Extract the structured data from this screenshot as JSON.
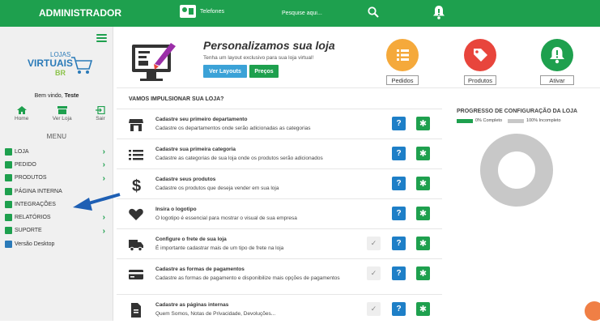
{
  "header": {
    "title": "ADMINISTRADOR",
    "phone_label": "Telefones",
    "search_placeholder": "Pesquise aqui...",
    "icons": [
      "phone-card-icon",
      "search-icon",
      "bell-icon"
    ]
  },
  "sidebar": {
    "logo_text": "LOJAS VIRTUAIS BR",
    "welcome_prefix": "Bem vindo, ",
    "user": "Teste",
    "quick": [
      {
        "label": "Home",
        "icon": "home-icon"
      },
      {
        "label": "Ver Loja",
        "icon": "store-icon"
      },
      {
        "label": "Sair",
        "icon": "exit-icon"
      }
    ],
    "menu_title": "MENU",
    "items": [
      {
        "label": "LOJA",
        "icon": "store-icon",
        "chevron": true
      },
      {
        "label": "PEDIDO",
        "icon": "list-icon",
        "chevron": true
      },
      {
        "label": "PRODUTOS",
        "icon": "plus-icon",
        "chevron": true
      },
      {
        "label": "PÁGINA INTERNA",
        "icon": "page-icon",
        "chevron": false
      },
      {
        "label": "INTEGRAÇÕES",
        "icon": "integration-icon",
        "chevron": false
      },
      {
        "label": "RELATÓRIOS",
        "icon": "report-icon",
        "chevron": true
      },
      {
        "label": "SUPORTE",
        "icon": "help-icon",
        "chevron": true
      },
      {
        "label": "Versão Desktop",
        "icon": "monitor-icon",
        "chevron": false
      }
    ]
  },
  "banner": {
    "title": "Personalizamos sua loja",
    "subtitle": "Tenha um layout exclusivo para sua loja virtual!",
    "btn_layouts": "Ver Layouts",
    "btn_precos": "Preços"
  },
  "shortcuts": [
    {
      "label": "Pedidos",
      "color": "#f5a93b",
      "icon": "list-icon"
    },
    {
      "label": "Produtos",
      "color": "#e8453c",
      "icon": "tag-icon"
    },
    {
      "label": "Ativar",
      "color": "#1ea04e",
      "icon": "bell-icon"
    }
  ],
  "main": {
    "heading": "VAMOS IMPULSIONAR SUA LOJA?",
    "tasks": [
      {
        "title": "Cadastre seu primeiro departamento",
        "desc": "Cadastre os departamentos onde serão adicionadas as categorias",
        "icon": "store-icon",
        "done": false
      },
      {
        "title": "Cadastre sua primeira categoria",
        "desc": "Cadastre as categorias de sua loja onde os produtos serão adicionados",
        "icon": "list-icon",
        "done": false
      },
      {
        "title": "Cadastre seus produtos",
        "desc": "Cadastre os produtos que deseja vender em sua loja",
        "icon": "dollar-icon",
        "done": false
      },
      {
        "title": "Insira o logotipo",
        "desc": "O logotipo é essencial para mostrar o visual de sua empresa",
        "icon": "heart-icon",
        "done": false
      },
      {
        "title": "Configure o frete de sua loja",
        "desc": "É importante cadastrar mais de um tipo de frete na loja",
        "icon": "truck-icon",
        "done": true
      },
      {
        "title": "Cadastre as formas de pagamentos",
        "desc": "Cadastre as formas de pagamento e disponibilize mais opções de pagamentos",
        "icon": "card-icon",
        "done": true
      },
      {
        "title": "Cadastre as páginas internas",
        "desc": "Quem Somos, Notas de Privacidade, Devoluções...",
        "icon": "file-icon",
        "done": true
      }
    ]
  },
  "progress": {
    "title": "PROGRESSO DE CONFIGURAÇÃO DA LOJA",
    "legend_complete": "0% Completo",
    "legend_incomplete": "100% Incompleto",
    "complete_color": "#1ea04e",
    "incomplete_color": "#c8c8c8",
    "complete_fraction": 0
  }
}
